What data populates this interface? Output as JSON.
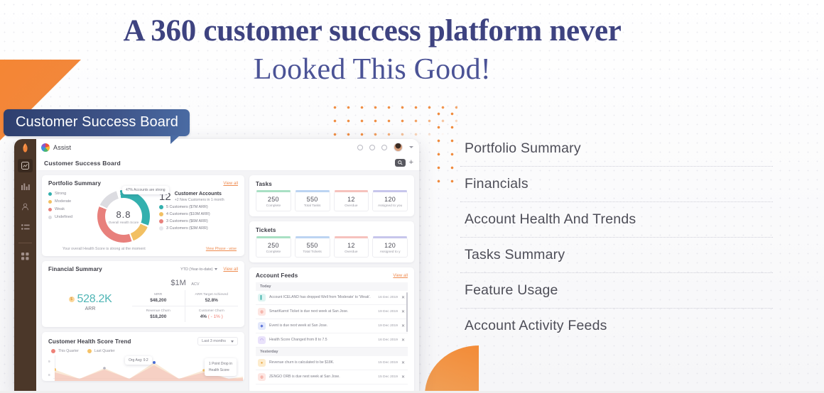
{
  "headline": {
    "line1": "A 360 customer success platform never",
    "line2": "Looked This Good!"
  },
  "board_badge": {
    "label": "Customer Success Board"
  },
  "app": {
    "brand": "Assist",
    "page_title": "Customer Success Board",
    "topbar_icons": [
      "help-circle-icon",
      "gear-icon",
      "bell-icon",
      "avatar"
    ],
    "subbar_icons": [
      "search-icon",
      "add-icon"
    ],
    "rail_icons": [
      "logo-icon",
      "dashboard-icon",
      "analytics-icon",
      "contacts-icon",
      "list-icon",
      "apps-icon"
    ]
  },
  "portfolio": {
    "title": "Portfolio Summary",
    "view_all": "View all",
    "legend": [
      {
        "label": "Strong",
        "color": "#33b0ae"
      },
      {
        "label": "Moderate",
        "color": "#f2c063"
      },
      {
        "label": "Weak",
        "color": "#e8807c"
      },
      {
        "label": "Undefined",
        "color": "#dcdce1"
      }
    ],
    "tooltip": "47% Accounts are strong",
    "score": "8.8",
    "score_label": "Overall Health Score",
    "accounts_count": "12",
    "accounts_title": "Customer Accounts",
    "accounts_sub": "+2 New Customers in 1 month",
    "breakdown": [
      {
        "text": "5 Customers ($7M  ARR)",
        "color": "#33b0ae"
      },
      {
        "text": "4 Customers ($10M ARR)",
        "color": "#f2c063"
      },
      {
        "text": "3 Customers ($6M  ARR)",
        "color": "#e8807c"
      },
      {
        "text": "3 Customers ($3M  ARR)",
        "color": "#dcdce1"
      }
    ],
    "note": "Your overall Health Score is strong at the moment",
    "footer_link": "View Phase - wise"
  },
  "tasks": {
    "title": "Tasks",
    "kpis": [
      {
        "value": "250",
        "label": "Complete",
        "color": "#a9e0c4"
      },
      {
        "value": "550",
        "label": "Total Tasks",
        "color": "#bcd4f2"
      },
      {
        "value": "12",
        "label": "Overdue",
        "color": "#f6c2bd"
      },
      {
        "value": "120",
        "label": "Assigned to you",
        "color": "#c7c6ec"
      }
    ]
  },
  "tickets": {
    "title": "Tickets",
    "kpis": [
      {
        "value": "250",
        "label": "Complete",
        "color": "#a9e0c4"
      },
      {
        "value": "550",
        "label": "Total Tickets",
        "color": "#bcd4f2"
      },
      {
        "value": "12",
        "label": "Overdue",
        "color": "#f6c2bd"
      },
      {
        "value": "120",
        "label": "Assigned to y",
        "color": "#c7c6ec"
      }
    ]
  },
  "financial": {
    "title": "Financial Summary",
    "range": "YTD (Year-to-date)",
    "view_all": "View all",
    "currency_badge": "$",
    "arr_value": "528.2K",
    "arr_label": "ARR",
    "acv_value": "$1M",
    "acv_label": "ACV",
    "cells": [
      {
        "label": "MRR",
        "value": "$48,200"
      },
      {
        "label": "ARR Target Achieved",
        "value": "52.8%"
      },
      {
        "label": "Revenue Churn",
        "value": "$18,200"
      },
      {
        "label": "Customer Churn",
        "value": "4%",
        "delta": "( - 1% )"
      }
    ]
  },
  "trend": {
    "title": "Customer Health Score Trend",
    "range": "Last 3 months",
    "legend": [
      {
        "label": "This Quarter",
        "color": "#ee8279"
      },
      {
        "label": "Last Quarter",
        "color": "#f5c268"
      }
    ],
    "tooltip": "Org Avg: 9.2",
    "callout_line1": "1 Point Drop in",
    "callout_line2": "Health Score",
    "y_ticks": [
      "9",
      "8"
    ]
  },
  "feeds": {
    "title": "Account Feeds",
    "view_all": "View all",
    "groups": [
      {
        "label": "Today",
        "items": [
          {
            "text": "Account ICELAND has dropped Well from 'Moderate' to 'Weak'.",
            "date": "16 Dec 2019",
            "icon": "document-icon",
            "color": "#dff4f2",
            "glyph": "▌"
          },
          {
            "text": "SmartKarrot Ticket is due next week at San Jose.",
            "date": "19 Dec 2019",
            "icon": "ticket-icon",
            "color": "#fde6e2",
            "glyph": "◍"
          },
          {
            "text": "Event is due next week at San Jose.",
            "date": "19 Dec 2019",
            "icon": "bell-icon",
            "color": "#e3e8fb",
            "glyph": "◆"
          },
          {
            "text": "Health Score Changed from 8 to 7.5",
            "date": "16 Dec 2019",
            "icon": "pulse-icon",
            "color": "#e9e2fb",
            "glyph": "◠"
          }
        ]
      },
      {
        "label": "Yesterday",
        "items": [
          {
            "text": "Revenue churn is calculated to be $18K.",
            "date": "15 Dec 2019",
            "icon": "coin-icon",
            "color": "#fdeccd",
            "glyph": "●"
          },
          {
            "text": "ZENGO ORB is due next week at San Jose.",
            "date": "15 Dec 2019",
            "icon": "ticket-icon",
            "color": "#fde6e2",
            "glyph": "◍"
          }
        ]
      }
    ]
  },
  "features": [
    {
      "label": "Portfolio Summary"
    },
    {
      "label": "Financials"
    },
    {
      "label": "Account Health And Trends"
    },
    {
      "label": "Tasks Summary"
    },
    {
      "label": "Feature Usage"
    },
    {
      "label": "Account Activity Feeds"
    }
  ]
}
